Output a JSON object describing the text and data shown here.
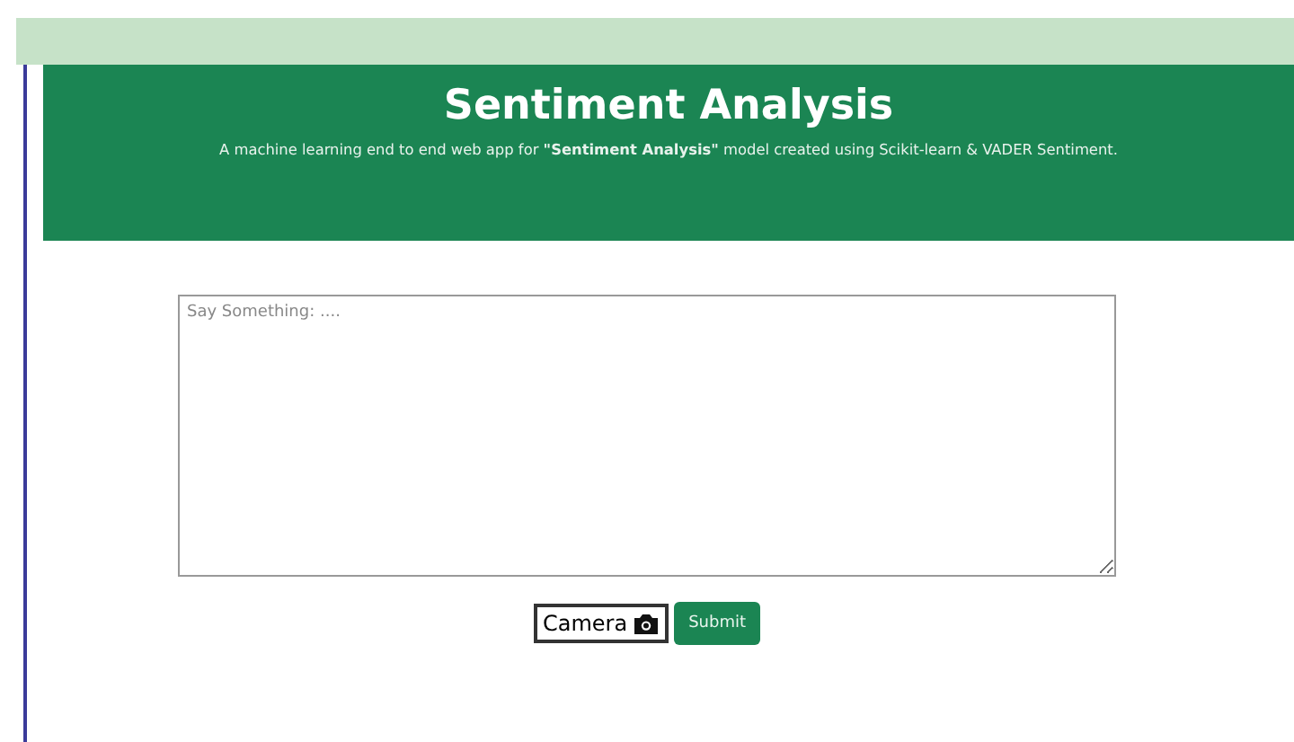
{
  "header": {
    "title": "Sentiment Analysis",
    "subtitle": "A machine learning end to end web app for **\"Sentiment Analysis\"** model created using Scikit-learn & VADER Sentiment."
  },
  "input": {
    "placeholder": "Say Something: ...."
  },
  "buttons": [
    {
      "label": "Camera",
      "kind": "camera"
    },
    {
      "label": "Submit",
      "kind": "primary"
    }
  ]
}
